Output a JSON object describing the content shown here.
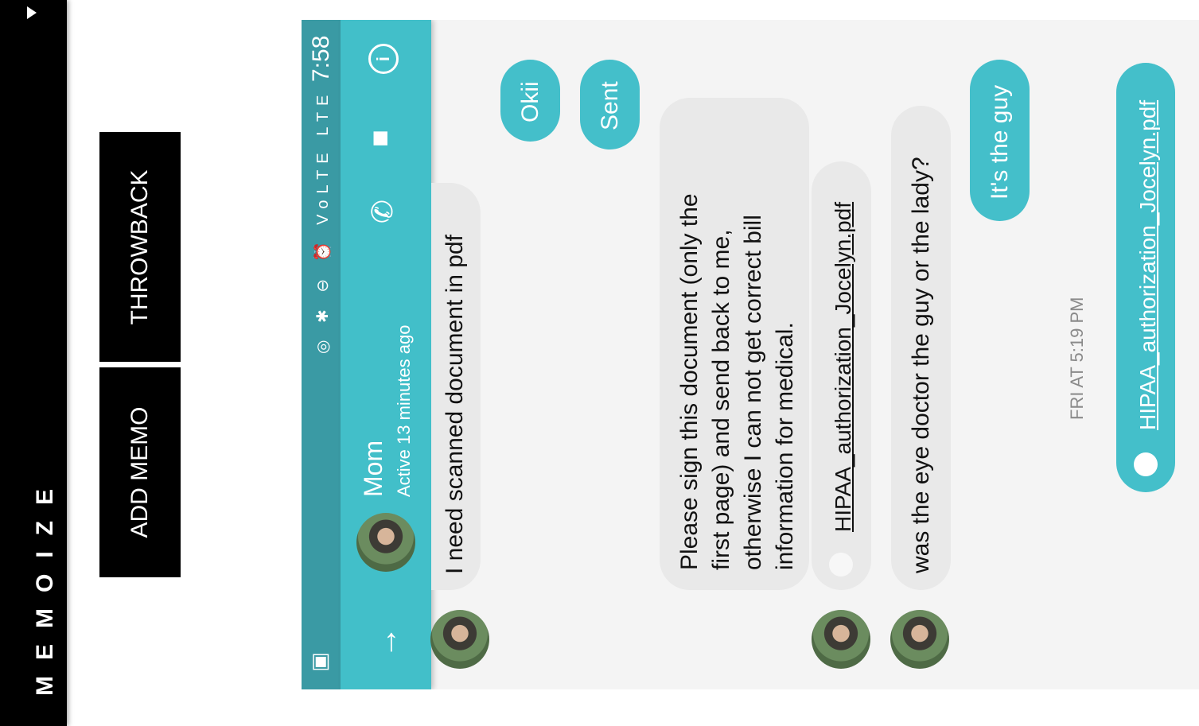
{
  "sidebar": {
    "brand": "MEMOIZE"
  },
  "buttons": {
    "throwback": "THROWBACK",
    "add_memo": "ADD MEMO"
  },
  "status_bar": {
    "time": "7:58",
    "icons_text": "◎ ✱ ⊖ ⏰ VoLTE LTE"
  },
  "contact": {
    "name": "Mom",
    "status": "Active 13 minutes ago"
  },
  "messages": {
    "m1": "I need scanned document in pdf",
    "m2": "Okii",
    "m3": "Sent",
    "m4": [
      "Please sign this document (only the",
      "first page) and send back to me,",
      "otherwise I can not get correct bill",
      "information for medical."
    ],
    "m5": "HIPAA_authorization_Jocelyn.pdf",
    "m6": "was the eye doctor the guy or the lady?",
    "m7": "It's the guy",
    "timestamp": "FRI AT 5:19 PM",
    "m8": "HIPAA_authorization_Jocelyn.pdf"
  },
  "colors": {
    "accent": "#42bfc9",
    "status_bar": "#3a9aa4",
    "incoming": "#e9e9e9"
  }
}
